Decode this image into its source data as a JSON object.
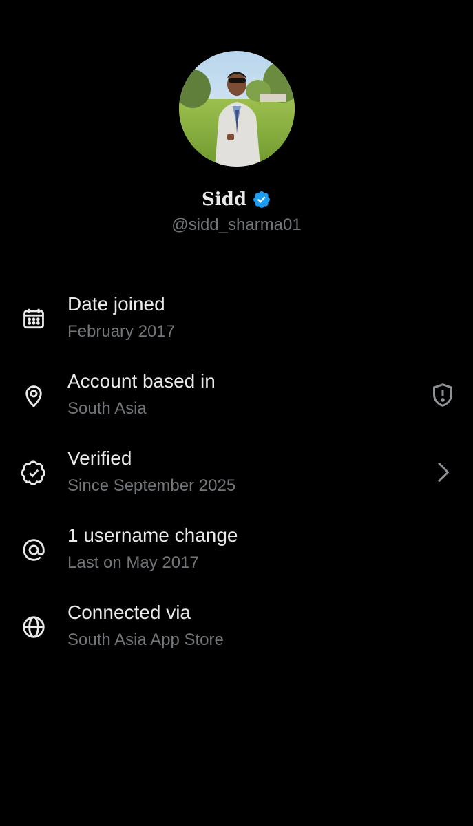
{
  "profile": {
    "display_name": "Sidd",
    "handle": "@sidd_sharma01",
    "verified": true,
    "verified_color": "#1d9bf0"
  },
  "about": {
    "items": [
      {
        "icon": "calendar-icon",
        "title": "Date joined",
        "subtitle": "February 2017"
      },
      {
        "icon": "location-pin-icon",
        "title": "Account based in",
        "subtitle": "South Asia",
        "trailing_icon": "shield-alert-icon"
      },
      {
        "icon": "verified-check-icon",
        "title": "Verified",
        "subtitle": "Since September 2025",
        "trailing_icon": "chevron-right-icon"
      },
      {
        "icon": "at-sign-icon",
        "title": "1 username change",
        "subtitle": "Last on May 2017"
      },
      {
        "icon": "globe-icon",
        "title": "Connected via",
        "subtitle": "South Asia App Store"
      }
    ]
  },
  "colors": {
    "background": "#000000",
    "primary_text": "#e7e9ea",
    "secondary_text": "#71767b",
    "accent": "#1d9bf0"
  }
}
